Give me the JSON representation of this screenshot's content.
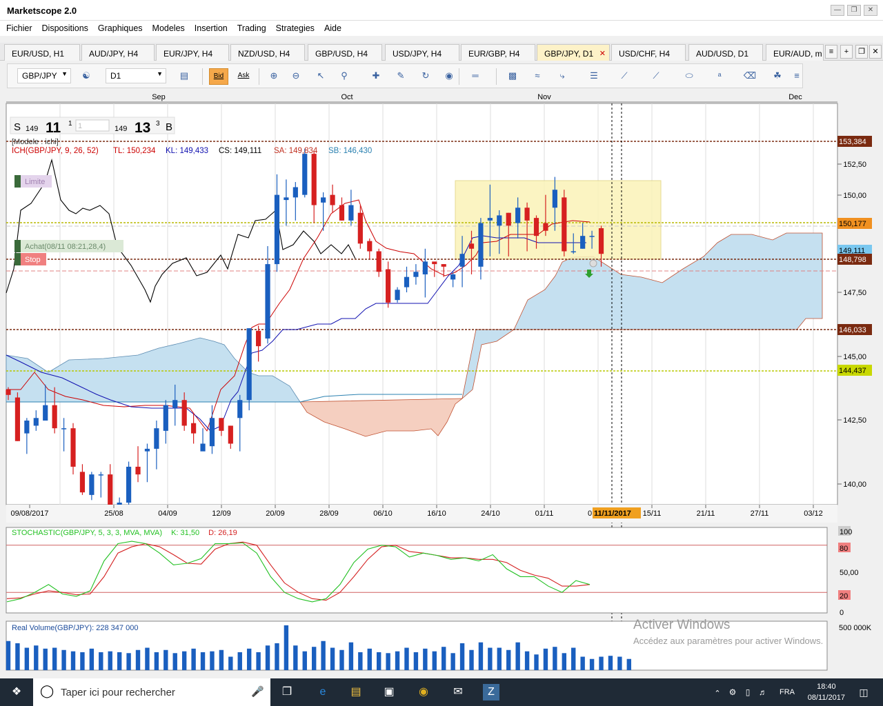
{
  "app": {
    "title": "Marketscope 2.0"
  },
  "menu": [
    "Fichier",
    "Dispositions",
    "Graphiques",
    "Modeles",
    "Insertion",
    "Trading",
    "Strategies",
    "Aide"
  ],
  "tabs": [
    "EUR/USD, H1",
    "AUD/JPY, H4",
    "EUR/JPY, H4",
    "NZD/USD, H4",
    "GBP/USD, H4",
    "USD/JPY, H4",
    "EUR/GBP, H4",
    "GBP/JPY, D1",
    "USD/CHF, H4",
    "AUD/USD, D1",
    "EUR/AUD, m"
  ],
  "active_tab": "GBP/JPY, D1",
  "toolbar": {
    "instrument": "GBP/JPY",
    "timeframe": "D1",
    "bid_label": "Bid",
    "ask_label": "Ask"
  },
  "chart": {
    "months": [
      "Sep",
      "Oct",
      "Nov",
      "Dec"
    ],
    "sell": {
      "label": "S",
      "big": "149",
      "pips": "11",
      "frac": "1"
    },
    "buy": {
      "label": "B",
      "big": "149",
      "pips": "13",
      "frac": "3"
    },
    "amount": "1",
    "template_label": "[Modele : ichi]",
    "ichimoku": {
      "name": "ICH(GBP/JPY, 9, 26, 52)",
      "tl": "TL: 150,234",
      "kl": "KL: 149,433",
      "cs": "CS: 149,111",
      "sa": "SA: 149,834",
      "sb": "SB: 146,430"
    },
    "order_labels": {
      "limit": "Limite",
      "entry": "Achat(08/11 08:21,28,4)",
      "stop": "Stop"
    },
    "price_ticks": [
      "152,50",
      "150,00",
      "147,50",
      "145,00",
      "142,50",
      "140,00"
    ],
    "price_tags": {
      "resistance": "153,384",
      "limit": "150,177",
      "current": "149,111",
      "stop": "148,798",
      "support": "146,033",
      "low": "144,437"
    },
    "date_ticks": [
      "09/08/2017",
      "25/08",
      "04/09",
      "12/09",
      "20/09",
      "28/09",
      "06/10",
      "16/10",
      "24/10",
      "01/11",
      "0",
      "15/11",
      "21/11",
      "27/11",
      "03/12"
    ],
    "cursor_date": "11/11/2017",
    "stochastic": {
      "label": "STOCHASTIC(GBP/JPY, 5, 3, 3, MVA, MVA)",
      "k": "K: 31,50",
      "d": "D: 26,19",
      "ticks": [
        "100",
        "80",
        "50,00",
        "20",
        "0"
      ]
    },
    "volume": {
      "label": "Real Volume(GBP/JPY): 228 347 000",
      "tick": "500 000K"
    }
  },
  "watermark": {
    "title": "Activer Windows",
    "sub": "Accédez aux paramètres pour activer Windows."
  },
  "taskbar": {
    "search_placeholder": "Taper ici pour rechercher",
    "lang": "FRA",
    "time": "18:40",
    "date": "08/11/2017"
  },
  "colors": {
    "bull": "#1a5fbf",
    "bear": "#d62020",
    "tenkan": "#cc0000",
    "kijun": "#1010b0",
    "chikou": "#000000",
    "kumo_up": "#c5e0f0",
    "kumo_down": "#f5cfc0",
    "stoch_k": "#22c022",
    "stoch_d": "#d42020",
    "volume": "#1a5fbf"
  },
  "chart_data": {
    "type": "candlestick",
    "candles": [
      [
        143.7,
        143.5,
        143.8,
        143.3
      ],
      [
        143.4,
        141.7,
        143.6,
        141.7
      ],
      [
        142.0,
        142.5,
        142.6,
        141.2
      ],
      [
        142.3,
        142.6,
        142.9,
        142.1
      ],
      [
        142.5,
        143.1,
        143.9,
        142.5
      ],
      [
        143.1,
        142.2,
        143.8,
        142.0
      ],
      [
        142.2,
        142.2,
        142.6,
        141.3
      ],
      [
        142.2,
        140.7,
        142.4,
        140.4
      ],
      [
        140.5,
        139.7,
        140.8,
        139.6
      ],
      [
        139.6,
        140.4,
        140.5,
        139.4
      ],
      [
        140.4,
        140.4,
        140.5,
        139.5
      ],
      [
        140.4,
        139.1,
        140.8,
        138.8
      ],
      [
        139.1,
        139.3,
        139.5,
        138.8
      ],
      [
        139.3,
        140.7,
        140.9,
        139.1
      ],
      [
        140.7,
        140.4,
        141.5,
        140.1
      ],
      [
        141.3,
        141.4,
        141.6,
        140.1
      ],
      [
        141.4,
        142.2,
        142.5,
        140.6
      ],
      [
        142.1,
        143.1,
        143.3,
        141.6
      ],
      [
        143.0,
        143.3,
        143.9,
        142.3
      ],
      [
        143.3,
        142.3,
        143.6,
        142.1
      ],
      [
        142.4,
        142.0,
        142.8,
        141.6
      ],
      [
        141.3,
        141.6,
        142.2,
        141.6
      ],
      [
        141.5,
        142.6,
        143.1,
        141.2
      ],
      [
        142.6,
        142.1,
        142.6,
        141.9
      ],
      [
        142.3,
        141.6,
        142.3,
        141.4
      ],
      [
        142.6,
        143.3,
        143.5,
        141.3
      ],
      [
        143.3,
        146.1,
        146.1,
        142.9
      ],
      [
        146.0,
        145.4,
        146.2,
        144.8
      ],
      [
        145.7,
        148.6,
        149.3,
        145.5
      ],
      [
        148.6,
        151.3,
        152.1,
        148.3
      ],
      [
        151.1,
        151.2,
        151.9,
        150.1
      ],
      [
        151.2,
        151.6,
        151.8,
        150.3
      ],
      [
        151.3,
        152.9,
        153.1,
        151.2
      ],
      [
        152.9,
        150.9,
        153.0,
        150.2
      ],
      [
        151.0,
        151.2,
        151.4,
        149.9
      ],
      [
        151.3,
        150.9,
        151.7,
        150.6
      ],
      [
        150.9,
        150.3,
        151.2,
        150.3
      ],
      [
        150.3,
        150.9,
        151.5,
        150.1
      ],
      [
        150.6,
        149.4,
        150.9,
        149.2
      ],
      [
        149.5,
        149.1,
        149.6,
        148.8
      ],
      [
        149.1,
        148.3,
        149.2,
        148.1
      ],
      [
        148.4,
        147.1,
        148.7,
        146.9
      ],
      [
        147.2,
        147.6,
        147.7,
        147.1
      ],
      [
        147.7,
        148.1,
        148.5,
        147.5
      ],
      [
        148.1,
        148.3,
        148.6,
        147.8
      ],
      [
        148.2,
        148.7,
        149.2,
        147.3
      ],
      [
        148.7,
        148.6,
        148.6,
        148.1
      ],
      [
        148.6,
        148.5,
        148.6,
        148.1
      ],
      [
        148.0,
        148.2,
        148.3,
        147.7
      ],
      [
        148.5,
        149.0,
        149.7,
        147.7
      ],
      [
        149.4,
        149.2,
        149.9,
        148.2
      ],
      [
        148.5,
        150.2,
        150.4,
        148.0
      ],
      [
        150.3,
        150.4,
        151.7,
        148.9
      ],
      [
        150.1,
        150.5,
        150.7,
        149.0
      ],
      [
        150.6,
        150.1,
        150.6,
        148.9
      ],
      [
        150.2,
        150.8,
        151.2,
        149.6
      ],
      [
        150.8,
        150.3,
        151.0,
        149.1
      ],
      [
        150.4,
        149.7,
        150.5,
        149.2
      ],
      [
        150.2,
        149.9,
        151.3,
        149.7
      ],
      [
        150.8,
        151.5,
        152.0,
        149.9
      ],
      [
        151.2,
        149.1,
        151.5,
        148.9
      ],
      [
        149.1,
        149.1,
        149.8,
        149.0
      ],
      [
        149.2,
        149.7,
        150.2,
        149.2
      ],
      [
        149.7,
        149.7,
        149.9,
        149.2
      ],
      [
        150.0,
        149.0,
        150.1,
        148.5
      ]
    ],
    "stoch_k": [
      8,
      12,
      20,
      30,
      18,
      15,
      22,
      60,
      82,
      85,
      82,
      70,
      55,
      57,
      63,
      82,
      82,
      83,
      70,
      40,
      20,
      12,
      8,
      12,
      30,
      58,
      75,
      80,
      78,
      65,
      70,
      67,
      62,
      64,
      60,
      68,
      50,
      40,
      40,
      28,
      20,
      35,
      30
    ],
    "stoch_d": [
      12,
      13,
      18,
      22,
      20,
      17,
      18,
      40,
      70,
      78,
      82,
      78,
      68,
      57,
      56,
      75,
      82,
      84,
      80,
      55,
      32,
      20,
      12,
      10,
      20,
      40,
      62,
      78,
      80,
      72,
      70,
      67,
      64,
      64,
      62,
      62,
      58,
      48,
      42,
      38,
      28,
      28,
      30
    ],
    "volume": [
      65,
      60,
      50,
      55,
      48,
      50,
      45,
      42,
      40,
      48,
      40,
      42,
      40,
      38,
      45,
      50,
      40,
      45,
      38,
      42,
      48,
      40,
      42,
      45,
      30,
      40,
      48,
      40,
      55,
      60,
      100,
      55,
      42,
      52,
      65,
      50,
      45,
      62,
      40,
      48,
      40,
      38,
      42,
      50,
      40,
      48,
      42,
      52,
      38,
      60,
      45,
      62,
      50,
      50,
      45,
      62,
      42,
      35,
      48,
      52,
      38,
      50,
      30,
      25,
      30,
      32,
      30,
      25
    ]
  }
}
